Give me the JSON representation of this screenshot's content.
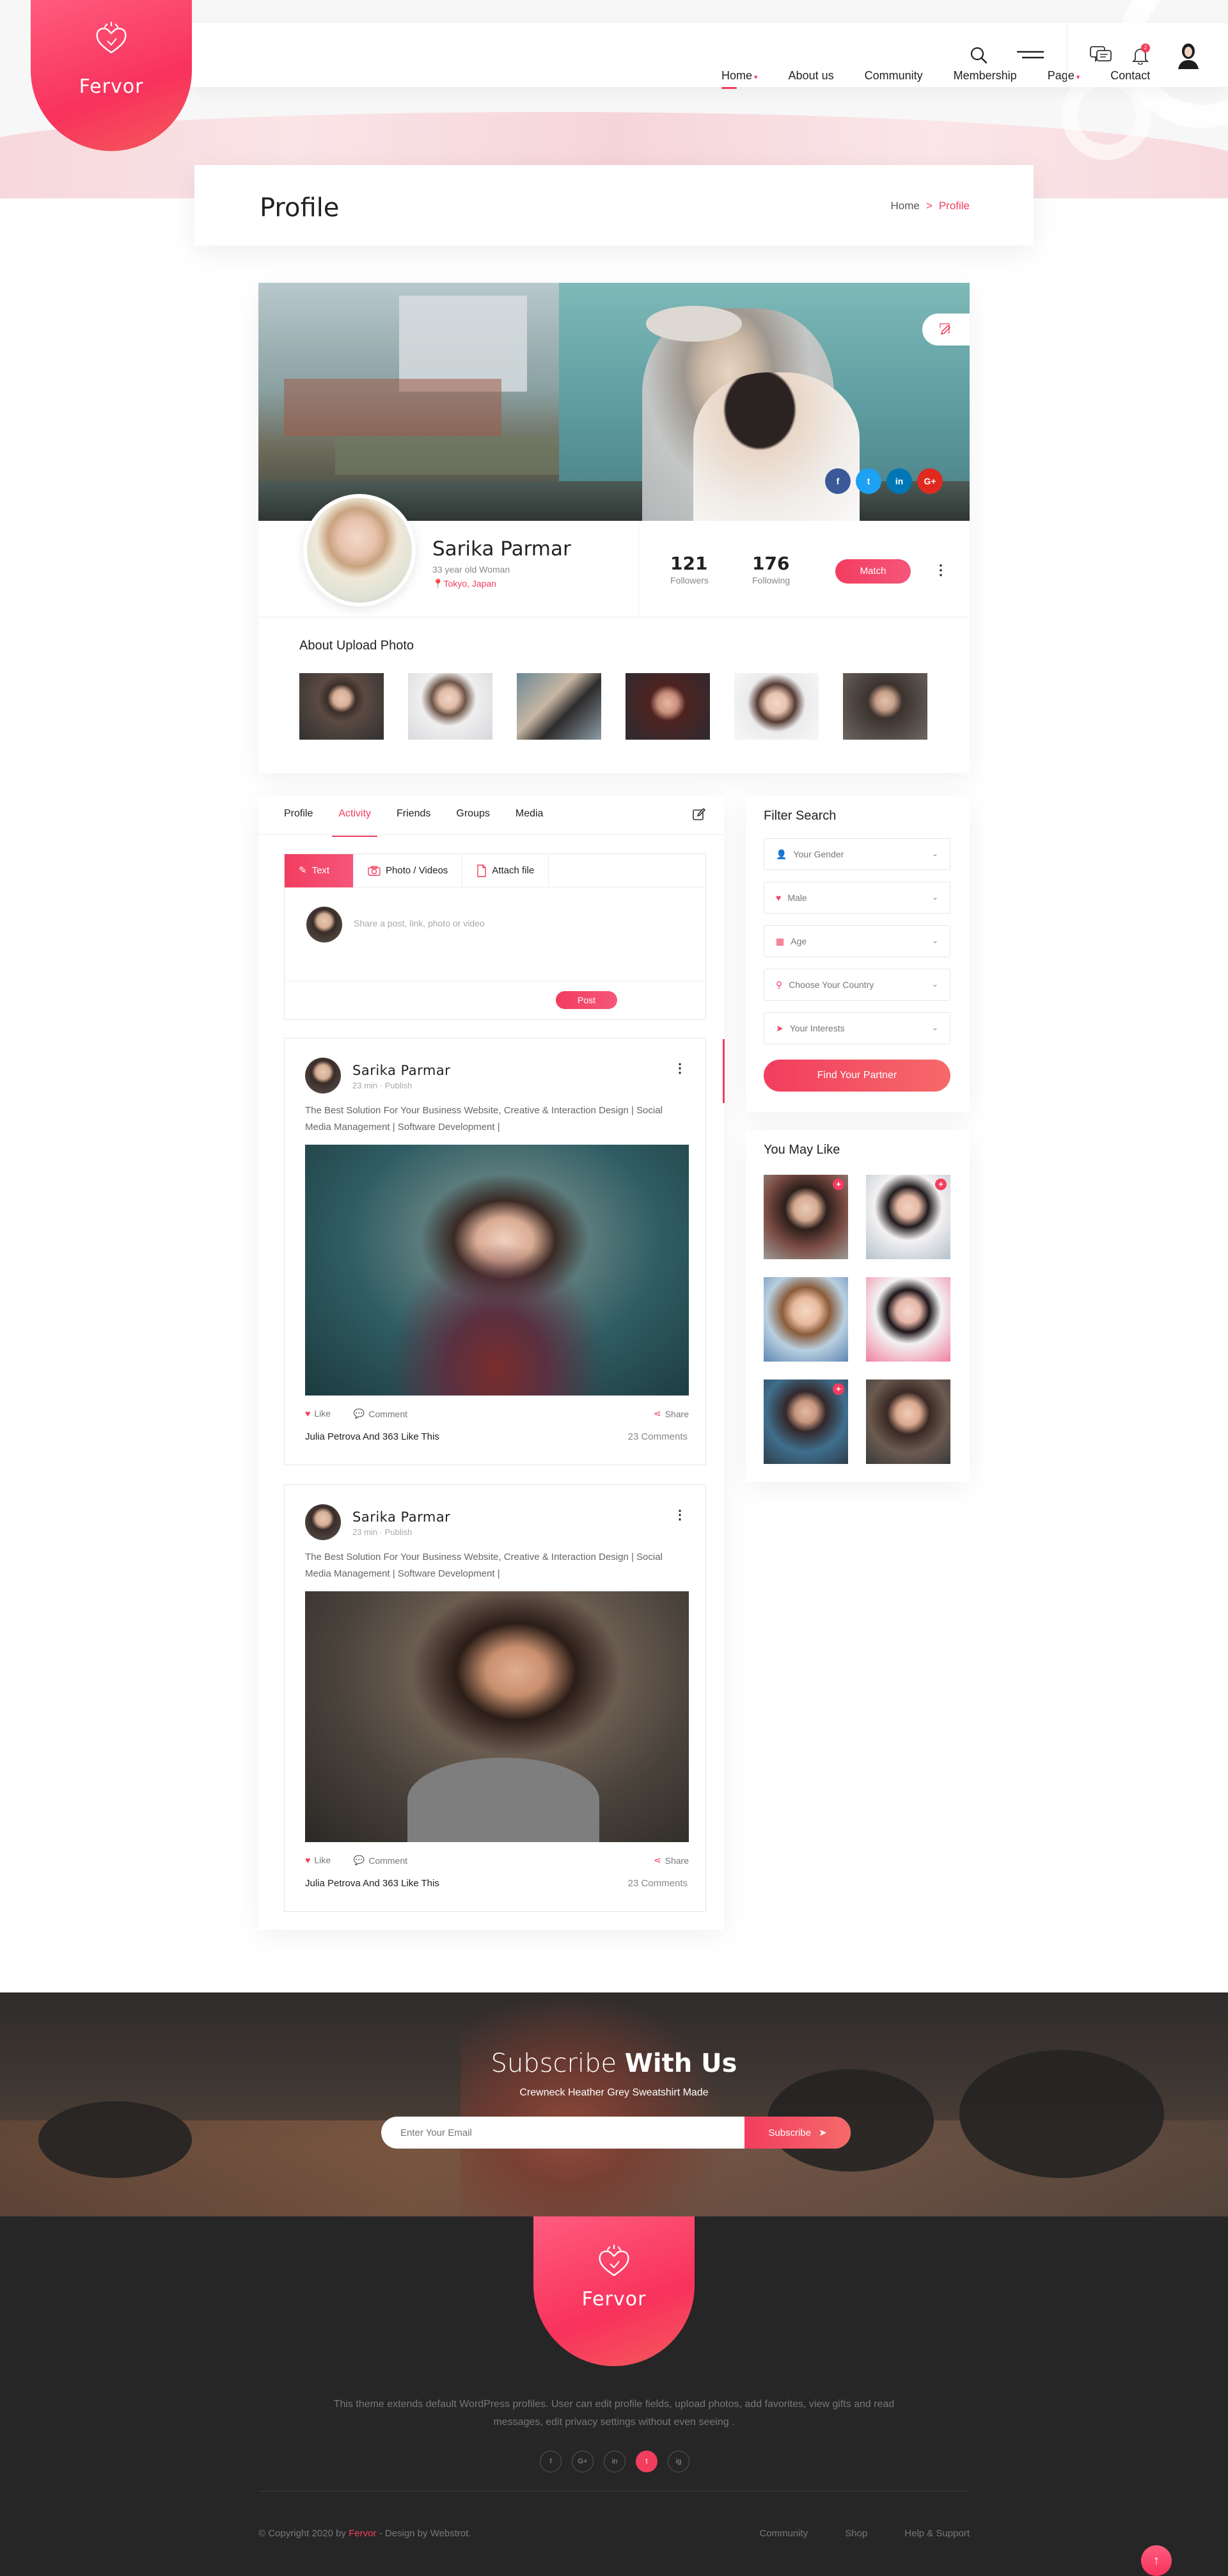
{
  "brand": {
    "name": "Fervor"
  },
  "nav": {
    "items": [
      {
        "label": "Home",
        "caret": true,
        "active": true
      },
      {
        "label": "About us",
        "caret": false
      },
      {
        "label": "Community",
        "caret": false
      },
      {
        "label": "Membership",
        "caret": false
      },
      {
        "label": "Page",
        "caret": true
      },
      {
        "label": "Contact",
        "caret": false
      }
    ],
    "icons": [
      "search-icon",
      "menu-icon",
      "messages-icon",
      "notifications-icon",
      "user-avatar"
    ],
    "notification_count": "2"
  },
  "page_title": "Profile",
  "breadcrumb": {
    "home": "Home",
    "separator": ">",
    "current": "Profile"
  },
  "profile": {
    "name": "Sarika Parmar",
    "meta": "33 year old Woman",
    "location": "Tokyo, Japan",
    "followers": {
      "value": "121",
      "label": "Followers"
    },
    "following": {
      "value": "176",
      "label": "Following"
    },
    "match_label": "Match",
    "social": [
      "f",
      "t",
      "in",
      "G+"
    ],
    "about_title": "About Upload Photo"
  },
  "tabs": [
    "Profile",
    "Activity",
    "Friends",
    "Groups",
    "Media"
  ],
  "active_tab": "Activity",
  "composer": {
    "tabs": [
      "Text",
      "Photo / Videos",
      "Attach file"
    ],
    "placeholder": "Share a post, link, photo or video",
    "post_label": "Post"
  },
  "posts": [
    {
      "author": "Sarika  Parmar",
      "time": "23 min",
      "status": "Publish",
      "text": "The Best Solution For Your Business Website, Creative & Interaction Design | Social Media Management | Software Development |",
      "like_label": "Like",
      "comment_label": "Comment",
      "share_label": "Share",
      "likes_text": "Julia Petrova And 363 Like This",
      "comments_text": "23 Comments"
    },
    {
      "author": "Sarika  Parmar",
      "time": "23 min",
      "status": "Publish",
      "text": "The Best Solution For Your Business Website, Creative & Interaction Design | Social Media Management | Software Development |",
      "like_label": "Like",
      "comment_label": "Comment",
      "share_label": "Share",
      "likes_text": "Julia Petrova And 363 Like This",
      "comments_text": "23 Comments"
    }
  ],
  "filter": {
    "title": "Filter Search",
    "fields": [
      "Your Gender",
      "Male",
      "Age",
      "Choose Your Country",
      "Your Interests"
    ],
    "button": "Find Your Partner"
  },
  "you_may_like": {
    "title": "You May Like"
  },
  "subscribe": {
    "title_light": "Subscribe",
    "title_bold": "With Us",
    "subtitle": "Crewneck Heather Grey Sweatshirt Made",
    "placeholder": "Enter Your Email",
    "button": "Subscribe"
  },
  "footer": {
    "description": "This theme extends default WordPress profiles. User can edit profile fields, upload photos, add favorites, view gifts and read messages, edit privacy settings without even seeing .",
    "social": [
      "f",
      "G+",
      "in",
      "t",
      "ig"
    ],
    "copyright_prefix": "© Copyright 2020 by",
    "copyright_brand": "Fervor",
    "copyright_suffix": "- Design by Webstrot.",
    "links": [
      "Community",
      "Shop",
      "Help & Support"
    ]
  },
  "colors": {
    "accent": "#f23d5f",
    "accent2": "#f56a6a",
    "footer_bg": "#262626"
  }
}
